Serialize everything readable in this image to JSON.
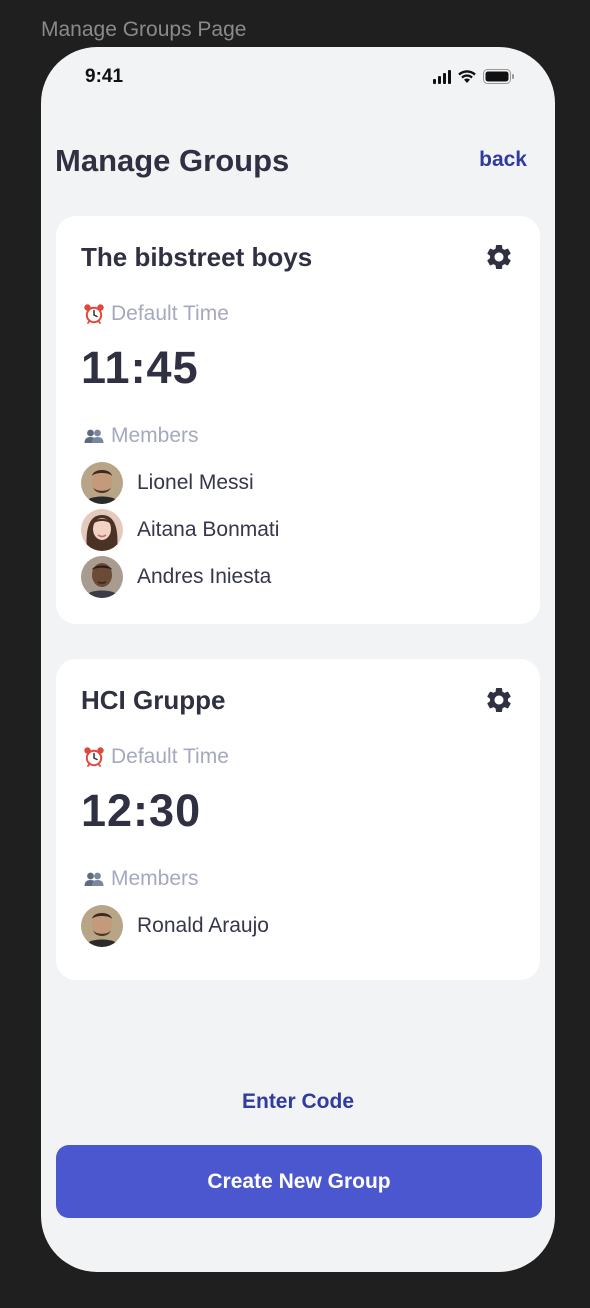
{
  "frame": {
    "label": "Manage Groups Page"
  },
  "status_bar": {
    "time": "9:41"
  },
  "header": {
    "title": "Manage Groups",
    "back_label": "back"
  },
  "groups": [
    {
      "name": "The bibstreet boys",
      "time_label": "Default Time",
      "default_time": "11:45",
      "members_label": "Members",
      "members": [
        {
          "name": "Lionel Messi"
        },
        {
          "name": "Aitana Bonmati"
        },
        {
          "name": "Andres Iniesta"
        }
      ]
    },
    {
      "name": "HCI Gruppe",
      "time_label": "Default Time",
      "default_time": "12:30",
      "members_label": "Members",
      "members": [
        {
          "name": "Ronald Araujo"
        }
      ]
    }
  ],
  "actions": {
    "enter_code_label": "Enter Code",
    "create_group_label": "Create New Group"
  },
  "colors": {
    "accent": "#4b57cf",
    "link": "#2f3ba0",
    "title_text": "#2f3042",
    "muted_text": "#a5a9bd",
    "background": "#f2f3f5"
  },
  "icons": {
    "settings": "gear-icon",
    "time": "alarm-clock-icon",
    "members": "people-icon"
  }
}
